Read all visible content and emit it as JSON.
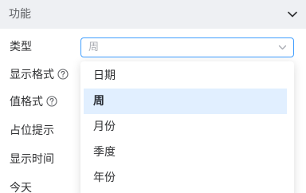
{
  "section": {
    "title": "功能",
    "toggle_icon": "chevron-down-icon"
  },
  "rows": {
    "type_label": "类型",
    "display_format_label": "显示格式",
    "value_format_label": "值格式",
    "placeholder_label": "占位提示",
    "show_time_label": "显示时间",
    "today_label": "今天"
  },
  "icons": {
    "help": "question-circle-icon",
    "select_arrow": "chevron-down-icon"
  },
  "select": {
    "placeholder": "周"
  },
  "dropdown": {
    "options": [
      "日期",
      "周",
      "月份",
      "季度",
      "年份"
    ],
    "selected_index": 1
  },
  "colors": {
    "accent": "#409eff",
    "header_bg": "#eef0f3",
    "selected_bg": "#e1efff",
    "text": "#303133",
    "muted": "#a8abb2"
  }
}
